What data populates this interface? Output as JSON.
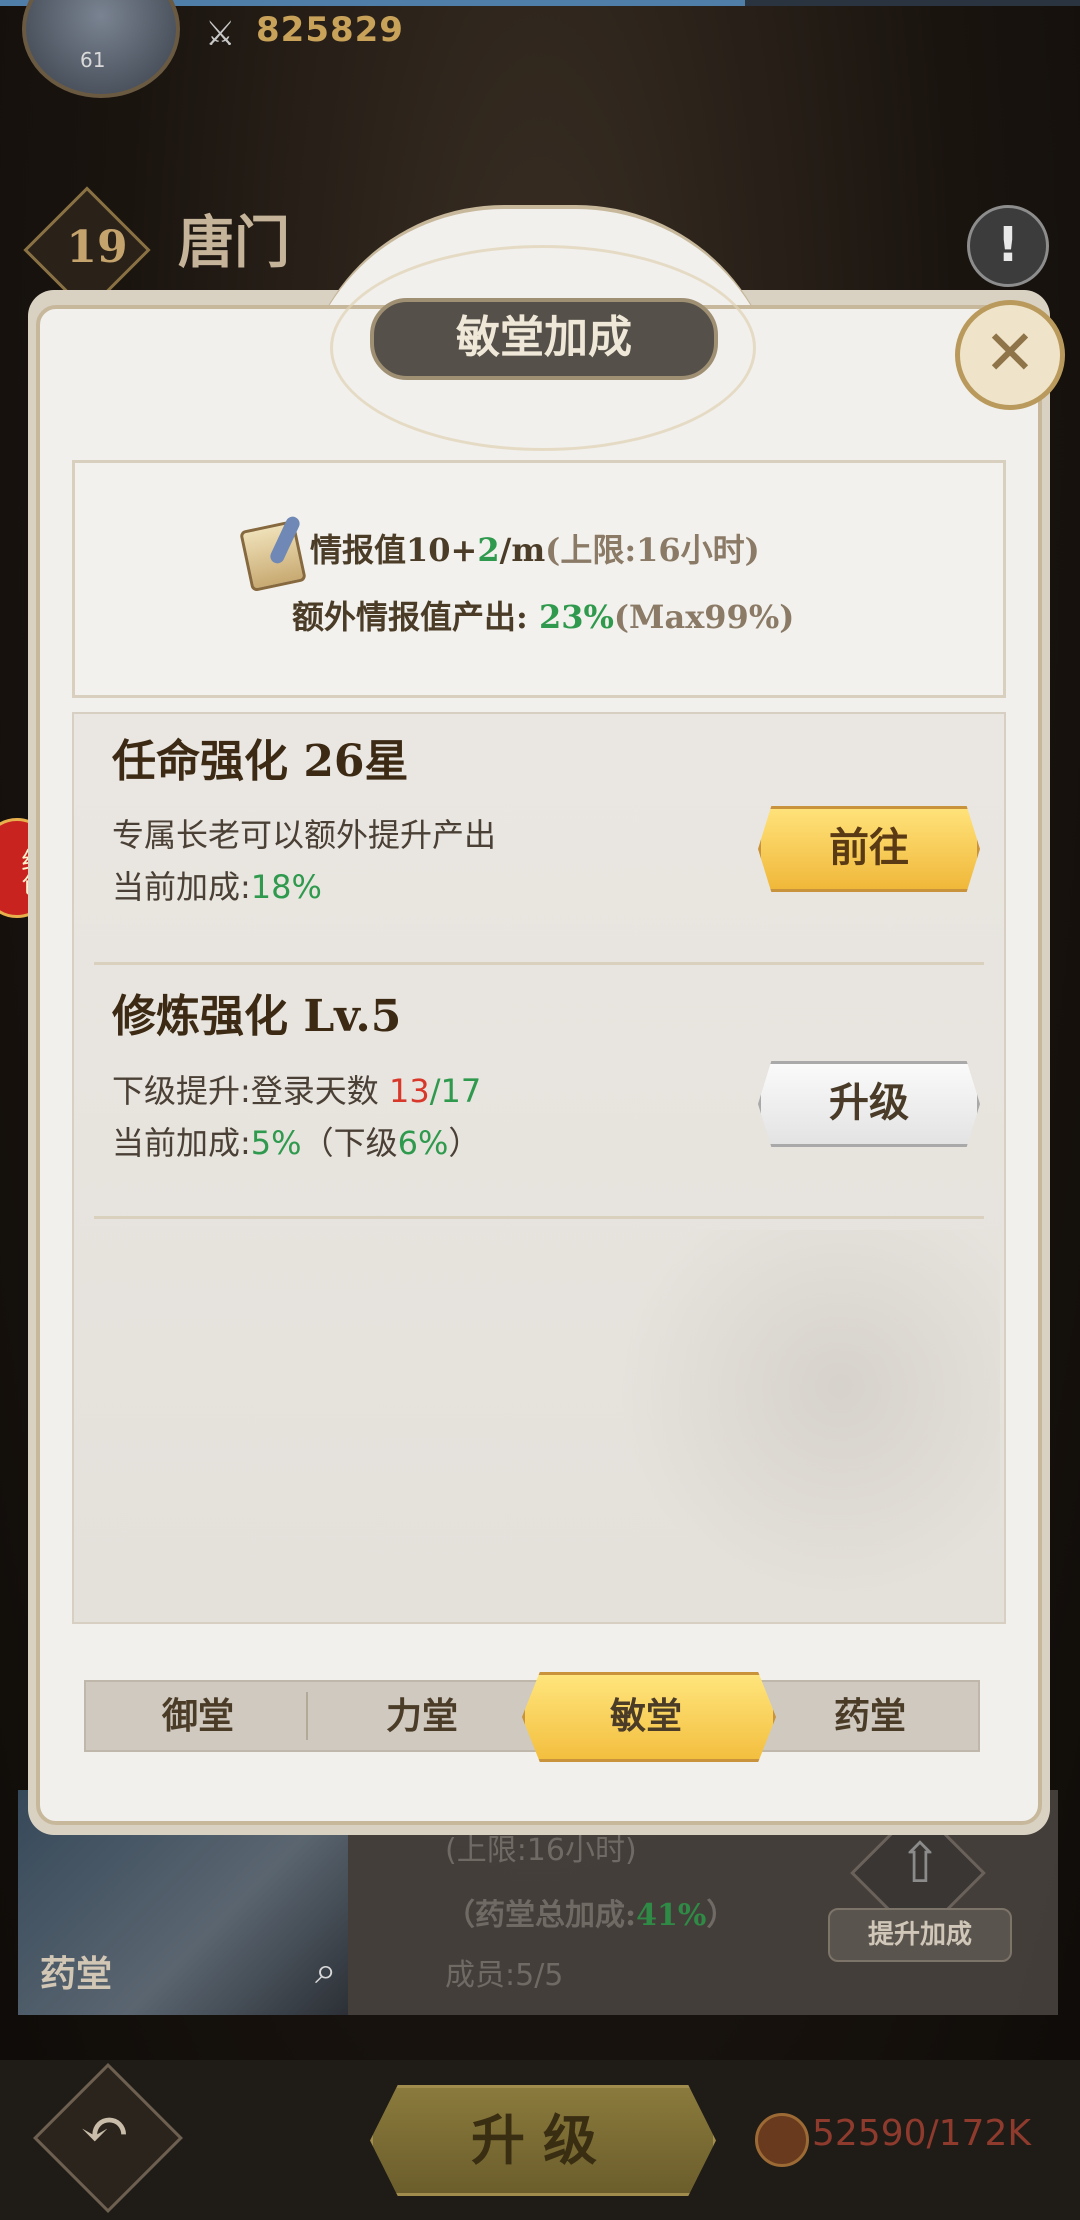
{
  "header": {
    "avatar_level": "61",
    "power_value": "825829",
    "guild_level": "19",
    "guild_name": "唐门",
    "side_badge": "红包"
  },
  "background": {
    "hall_name": "药堂",
    "cap_text": "(上限:16小时)",
    "total_bonus_label": "（药堂总加成:",
    "total_bonus_value": "41%",
    "total_bonus_close": "）",
    "members": "成员:5/5",
    "boost_button": "提升加成",
    "upgrade_button": "升级",
    "cost": "52590/172K"
  },
  "modal": {
    "title": "敏堂加成",
    "summary": {
      "line1_prefix": "情报值10+",
      "line1_rate": "2",
      "line1_unit": "/m",
      "line1_cap": "(上限:16小时)",
      "line2_label": "额外情报值产出:",
      "line2_value": "23%",
      "line2_max": "(Max99%)"
    },
    "rows": [
      {
        "title": "任命强化 26星",
        "desc": "专属长老可以额外提升产出",
        "bonus_label": "当前加成:",
        "bonus_value": "18%",
        "button": "前往"
      },
      {
        "title": "修炼强化 Lv.5",
        "next_label": "下级提升:登录天数 ",
        "next_current": "13",
        "next_total": "/17",
        "bonus_label": "当前加成:",
        "bonus_value": "5%",
        "bonus_next_open": "（下级",
        "bonus_next_value": "6%",
        "bonus_next_close": "）",
        "button": "升级"
      }
    ],
    "tabs": [
      "御堂",
      "力堂",
      "敏堂",
      "药堂"
    ],
    "active_tab": "敏堂"
  },
  "colors": {
    "accent_gold": "#f3bf3f",
    "value_green": "#2f9a4d",
    "value_red": "#d8382a"
  }
}
